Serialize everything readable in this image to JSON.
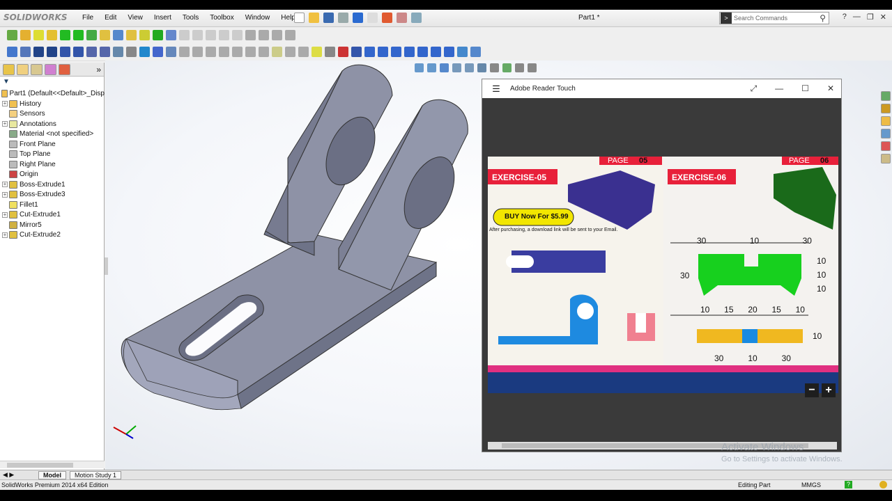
{
  "app": {
    "logo": "SOLIDWORKS",
    "doc_title": "Part1 *",
    "search_placeholder": "Search Commands"
  },
  "menu": [
    "File",
    "Edit",
    "View",
    "Insert",
    "Tools",
    "Toolbox",
    "Window",
    "Help"
  ],
  "tree": {
    "root": "Part1  (Default<<Default>_Disp",
    "items": [
      {
        "label": "History",
        "exp": true
      },
      {
        "label": "Sensors",
        "exp": false
      },
      {
        "label": "Annotations",
        "exp": true
      },
      {
        "label": "Material <not specified>",
        "exp": false
      },
      {
        "label": "Front Plane",
        "exp": false
      },
      {
        "label": "Top Plane",
        "exp": false
      },
      {
        "label": "Right Plane",
        "exp": false
      },
      {
        "label": "Origin",
        "exp": false
      },
      {
        "label": "Boss-Extrude1",
        "exp": true
      },
      {
        "label": "Boss-Extrude3",
        "exp": true
      },
      {
        "label": "Fillet1",
        "exp": false
      },
      {
        "label": "Cut-Extrude1",
        "exp": true
      },
      {
        "label": "Mirror5",
        "exp": false
      },
      {
        "label": "Cut-Extrude2",
        "exp": true
      }
    ]
  },
  "reader": {
    "title": "Adobe Reader Touch",
    "page_left": {
      "page_label": "PAGE",
      "page_no": "05",
      "exercise": "EXERCISE-05",
      "buy": "BUY Now For $5.99",
      "note": "After purchasing, a download link will be sent to your Email."
    },
    "page_right": {
      "page_label": "PAGE",
      "page_no": "06",
      "exercise": "EXERCISE-06"
    },
    "dims": {
      "top": [
        "30",
        "10",
        "30"
      ],
      "left": "30",
      "right": [
        "10",
        "10",
        "10"
      ],
      "bottom_row": [
        "10",
        "15",
        "20",
        "15",
        "10"
      ],
      "bar_right": "10",
      "bar_bottom": [
        "30",
        "10",
        "30"
      ]
    },
    "zoom_out": "−",
    "zoom_in": "+"
  },
  "tabs": [
    "Model",
    "Motion Study 1"
  ],
  "status": {
    "edition": "SolidWorks Premium 2014 x64 Edition",
    "mode": "Editing Part",
    "units": "MMGS",
    "help": "?"
  },
  "watermark": {
    "line1": "Activate Windows",
    "line2": "Go to Settings to activate Windows."
  }
}
